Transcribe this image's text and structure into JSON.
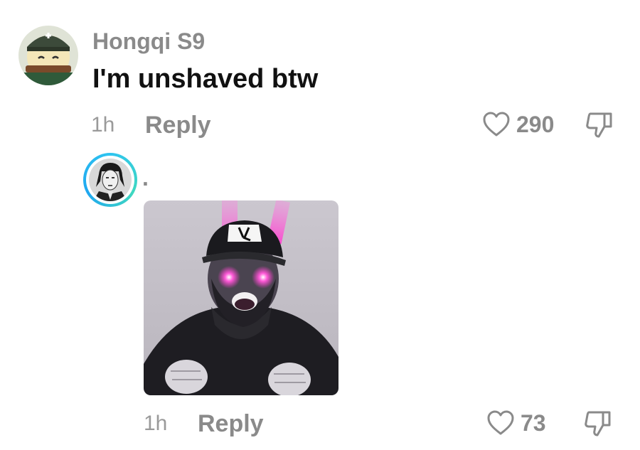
{
  "comment": {
    "username": "Hongqi S9",
    "text": "I'm unshaved btw",
    "time": "1h",
    "reply_label": "Reply",
    "like_count": "290",
    "icons": {
      "like": "heart-icon",
      "dislike": "thumbs-down-icon"
    }
  },
  "reply": {
    "username": ".",
    "time": "1h",
    "reply_label": "Reply",
    "like_count": "73",
    "icons": {
      "like": "heart-icon",
      "dislike": "thumbs-down-icon"
    }
  },
  "colors": {
    "muted_text": "#8a8a8a",
    "primary_text": "#111111",
    "story_ring": "#2ec4f0",
    "laser_pink": "#ff3fd0"
  }
}
